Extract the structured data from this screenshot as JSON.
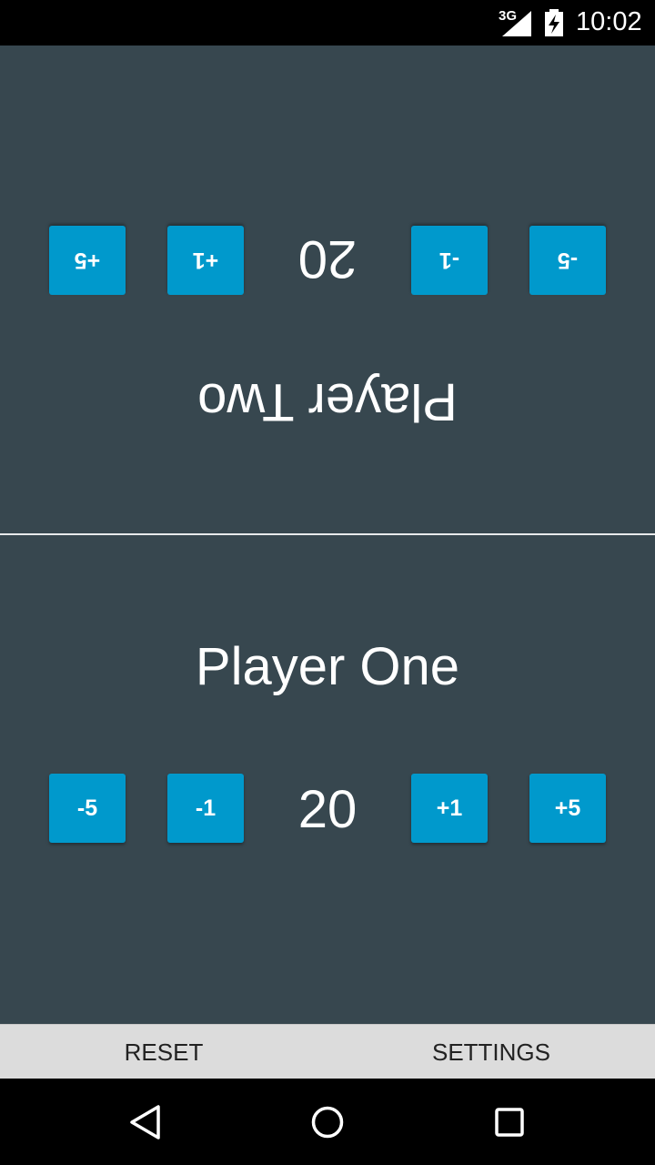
{
  "status_bar": {
    "network": "3G",
    "time": "10:02",
    "icons": [
      "signal-icon",
      "battery-charging-icon"
    ]
  },
  "player_two": {
    "name": "Player Two",
    "life": "20",
    "buttons": {
      "minus5": "-5",
      "minus1": "-1",
      "plus1": "+1",
      "plus5": "+5"
    }
  },
  "player_one": {
    "name": "Player One",
    "life": "20",
    "buttons": {
      "minus5": "-5",
      "minus1": "-1",
      "plus1": "+1",
      "plus5": "+5"
    }
  },
  "bottom_bar": {
    "reset_label": "RESET",
    "settings_label": "SETTINGS"
  },
  "nav_bar": {
    "icons": [
      "back-icon",
      "home-icon",
      "recents-icon"
    ]
  },
  "colors": {
    "panel_bg": "#37474f",
    "button_bg": "#0099cc",
    "bottom_bar_bg": "#dcdcdc"
  }
}
